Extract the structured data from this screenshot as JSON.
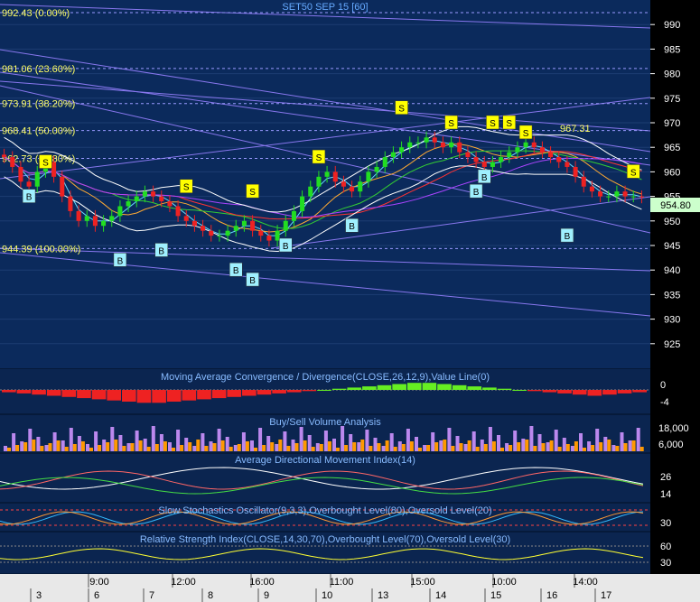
{
  "chart_data": [
    {
      "type": "candlestick",
      "title": "SET50 SEP 15  [60]",
      "ylim": [
        920,
        995
      ],
      "y_ticks": [
        "990",
        "985",
        "980",
        "975",
        "970",
        "965",
        "960",
        "955",
        "950",
        "945",
        "940",
        "935",
        "930",
        "925"
      ],
      "last_value": "954.80",
      "fibonacci": [
        {
          "label": "992.43 (0.00%)",
          "value": 992.43
        },
        {
          "label": "981.06 (23.60%)",
          "value": 981.06
        },
        {
          "label": "973.91 (38.20%)",
          "value": 973.91
        },
        {
          "label": "968.41 (50.00%)",
          "value": 968.41
        },
        {
          "label": "962.73 (61.80%)",
          "value": 962.73
        },
        {
          "label": "944.39 (100.00%)",
          "value": 944.39
        }
      ],
      "annotation": "967.31",
      "close": [
        963,
        961,
        958,
        957,
        960,
        962,
        959,
        955,
        952,
        950,
        951,
        949,
        950,
        951,
        953,
        954,
        955,
        956,
        955,
        954,
        953,
        951,
        950,
        949,
        948,
        947,
        947,
        948,
        949,
        950,
        948,
        947,
        946,
        948,
        950,
        952,
        955,
        957,
        959,
        960,
        958,
        957,
        956,
        958,
        960,
        961,
        963,
        964,
        965,
        966,
        966,
        967,
        966,
        965,
        966,
        964,
        963,
        962,
        961,
        962,
        963,
        964,
        965,
        966,
        965,
        964,
        963,
        962,
        961,
        959,
        957,
        956,
        955,
        955,
        956,
        955,
        955,
        954.8
      ],
      "signals": [
        {
          "label": "B",
          "i": 3,
          "price": 955
        },
        {
          "label": "S",
          "i": 5,
          "price": 962
        },
        {
          "label": "B",
          "i": 14,
          "price": 942
        },
        {
          "label": "B",
          "i": 19,
          "price": 944
        },
        {
          "label": "S",
          "i": 22,
          "price": 957
        },
        {
          "label": "B",
          "i": 28,
          "price": 940
        },
        {
          "label": "B",
          "i": 30,
          "price": 938
        },
        {
          "label": "S",
          "i": 30,
          "price": 956
        },
        {
          "label": "B",
          "i": 34,
          "price": 945
        },
        {
          "label": "S",
          "i": 38,
          "price": 963
        },
        {
          "label": "B",
          "i": 42,
          "price": 949
        },
        {
          "label": "S",
          "i": 48,
          "price": 973
        },
        {
          "label": "S",
          "i": 54,
          "price": 970
        },
        {
          "label": "B",
          "i": 57,
          "price": 956
        },
        {
          "label": "B",
          "i": 58,
          "price": 959
        },
        {
          "label": "S",
          "i": 59,
          "price": 970
        },
        {
          "label": "S",
          "i": 61,
          "price": 970
        },
        {
          "label": "S",
          "i": 63,
          "price": 968
        },
        {
          "label": "B",
          "i": 68,
          "price": 947
        },
        {
          "label": "S",
          "i": 76,
          "price": 960
        }
      ]
    },
    {
      "type": "histogram",
      "title": "Moving Average Convergence / Divergence(CLOSE,26,12,9),Value Line(0)",
      "y_ticks": [
        "0",
        "-4"
      ],
      "values": [
        -1,
        -1.5,
        -2,
        -2.5,
        -3,
        -3.5,
        -4,
        -4.5,
        -5,
        -5.5,
        -5.5,
        -5,
        -4.5,
        -4,
        -3.5,
        -3,
        -2.5,
        -2,
        -1.5,
        -1,
        -0.5,
        0,
        0.5,
        1,
        1.5,
        2,
        2.5,
        3,
        3,
        2.5,
        2,
        1.5,
        1,
        0.5,
        0,
        -0.5,
        -1,
        -1.5,
        -2,
        -2.5,
        -2,
        -1.5,
        -1
      ]
    },
    {
      "type": "bar",
      "title": "Buy/Sell Volume Analysis",
      "y_ticks": [
        "18,000",
        "6,000"
      ]
    },
    {
      "type": "line",
      "title": "Average Directional Movement Index(14)",
      "y_ticks": [
        "26",
        "14"
      ]
    },
    {
      "type": "line",
      "title": "Slow Stochastics Oscillator(9,3,3),Overbought Level(80),Oversold Level(20)",
      "y_ticks": [
        "30"
      ]
    },
    {
      "type": "line",
      "title": "Relative Strength Index(CLOSE,14,30,70),Overbought Level(70),Oversold Level(30)",
      "y_ticks": [
        "60",
        "30"
      ]
    }
  ],
  "time_axis": {
    "upper": [
      "9:00",
      "12:00",
      "16:00",
      "11:00",
      "15:00",
      "10:00",
      "14:00"
    ],
    "lower": [
      "3",
      "6",
      "7",
      "8",
      "9",
      "10",
      "13",
      "14",
      "15",
      "16",
      "17"
    ]
  },
  "colors": {
    "background": "#061a3a",
    "panel_bg": "#0b2550",
    "up": "#22dd22",
    "down": "#ee2222",
    "buy_bg": "#9ff0ff",
    "sell_bg": "#ffff00"
  }
}
